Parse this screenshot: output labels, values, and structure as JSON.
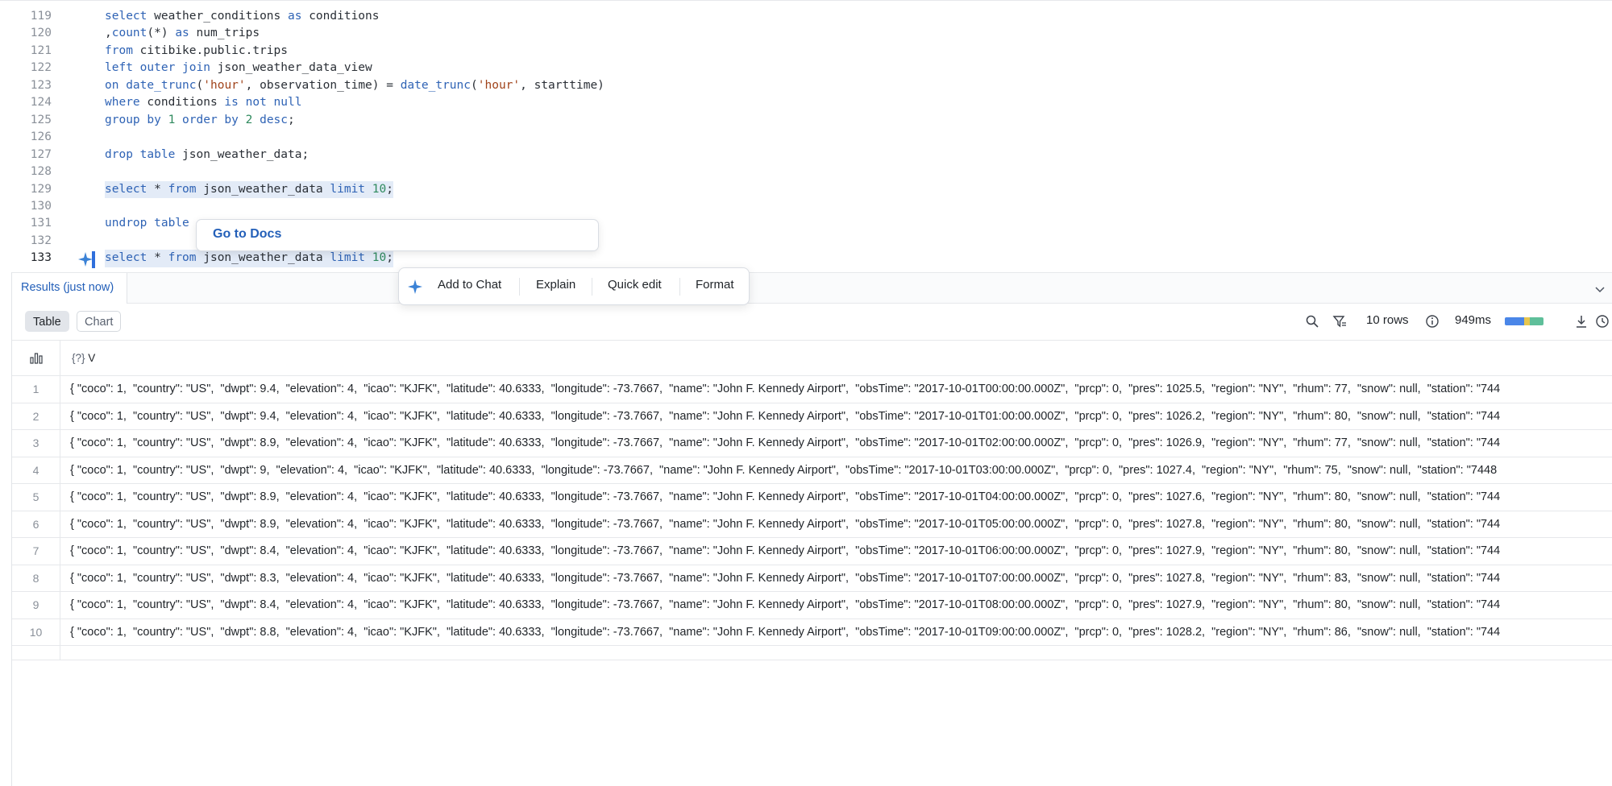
{
  "editor": {
    "lines": [
      {
        "n": "119",
        "segments": [
          {
            "t": "select",
            "c": "kw"
          },
          {
            "t": " weather_conditions "
          },
          {
            "t": "as",
            "c": "kw"
          },
          {
            "t": " conditions"
          }
        ]
      },
      {
        "n": "120",
        "segments": [
          {
            "t": ","
          },
          {
            "t": "count",
            "c": "fn"
          },
          {
            "t": "(*) "
          },
          {
            "t": "as",
            "c": "kw"
          },
          {
            "t": " num_trips"
          }
        ]
      },
      {
        "n": "121",
        "segments": [
          {
            "t": "from",
            "c": "kw"
          },
          {
            "t": " citibike.public.trips"
          }
        ]
      },
      {
        "n": "122",
        "segments": [
          {
            "t": "left outer join",
            "c": "kw"
          },
          {
            "t": " json_weather_data_view"
          }
        ]
      },
      {
        "n": "123",
        "segments": [
          {
            "t": "on",
            "c": "kw"
          },
          {
            "t": " "
          },
          {
            "t": "date_trunc",
            "c": "fn"
          },
          {
            "t": "("
          },
          {
            "t": "'hour'",
            "c": "str"
          },
          {
            "t": ", observation_time) = "
          },
          {
            "t": "date_trunc",
            "c": "fn"
          },
          {
            "t": "("
          },
          {
            "t": "'hour'",
            "c": "str"
          },
          {
            "t": ", starttime)"
          }
        ]
      },
      {
        "n": "124",
        "segments": [
          {
            "t": "where",
            "c": "kw"
          },
          {
            "t": " conditions "
          },
          {
            "t": "is not null",
            "c": "kw"
          }
        ]
      },
      {
        "n": "125",
        "segments": [
          {
            "t": "group by",
            "c": "kw"
          },
          {
            "t": " "
          },
          {
            "t": "1",
            "c": "num"
          },
          {
            "t": " "
          },
          {
            "t": "order by",
            "c": "kw"
          },
          {
            "t": " "
          },
          {
            "t": "2",
            "c": "num"
          },
          {
            "t": " "
          },
          {
            "t": "desc",
            "c": "kw"
          },
          {
            "t": ";"
          }
        ]
      },
      {
        "n": "126",
        "segments": []
      },
      {
        "n": "127",
        "segments": [
          {
            "t": "drop table",
            "c": "kw"
          },
          {
            "t": " json_weather_data;"
          }
        ]
      },
      {
        "n": "128",
        "segments": []
      },
      {
        "n": "129",
        "hl": true,
        "segments": [
          {
            "t": "select",
            "c": "kw"
          },
          {
            "t": " * "
          },
          {
            "t": "from",
            "c": "kw"
          },
          {
            "t": " json_weather_data "
          },
          {
            "t": "limit",
            "c": "kw"
          },
          {
            "t": " "
          },
          {
            "t": "10",
            "c": "num"
          },
          {
            "t": ";"
          }
        ]
      },
      {
        "n": "130",
        "segments": []
      },
      {
        "n": "131",
        "segments": [
          {
            "t": "undrop table",
            "c": "kw"
          }
        ]
      },
      {
        "n": "132",
        "segments": []
      },
      {
        "n": "133",
        "active": true,
        "hl": true,
        "segments": [
          {
            "t": "select",
            "c": "kw"
          },
          {
            "t": " * "
          },
          {
            "t": "from",
            "c": "kw"
          },
          {
            "t": " json_weather_data "
          },
          {
            "t": "limit",
            "c": "kw"
          },
          {
            "t": " "
          },
          {
            "t": "10",
            "c": "num"
          },
          {
            "t": ";"
          }
        ]
      }
    ]
  },
  "docs_popup": {
    "link": "Go to Docs"
  },
  "action_bar": {
    "add_to_chat": "Add to Chat",
    "explain": "Explain",
    "quick_edit": "Quick edit",
    "format": "Format"
  },
  "results": {
    "title": "Results (just now)",
    "tabs": {
      "table": "Table",
      "chart": "Chart"
    },
    "row_count": "10 rows",
    "duration": "949ms",
    "duration_colors": [
      "#4a86e8",
      "#e7c64f",
      "#5fbf9a"
    ],
    "column_type": "{?}",
    "column_name": "V",
    "rows": [
      {
        "n": "1",
        "v": "{ \"coco\": 1,  \"country\": \"US\",  \"dwpt\": 9.4,  \"elevation\": 4,  \"icao\": \"KJFK\",  \"latitude\": 40.6333,  \"longitude\": -73.7667,  \"name\": \"John F. Kennedy Airport\",  \"obsTime\": \"2017-10-01T00:00:00.000Z\",  \"prcp\": 0,  \"pres\": 1025.5,  \"region\": \"NY\",  \"rhum\": 77,  \"snow\": null,  \"station\": \"744"
      },
      {
        "n": "2",
        "v": "{ \"coco\": 1,  \"country\": \"US\",  \"dwpt\": 9.4,  \"elevation\": 4,  \"icao\": \"KJFK\",  \"latitude\": 40.6333,  \"longitude\": -73.7667,  \"name\": \"John F. Kennedy Airport\",  \"obsTime\": \"2017-10-01T01:00:00.000Z\",  \"prcp\": 0,  \"pres\": 1026.2,  \"region\": \"NY\",  \"rhum\": 80,  \"snow\": null,  \"station\": \"744"
      },
      {
        "n": "3",
        "v": "{ \"coco\": 1,  \"country\": \"US\",  \"dwpt\": 8.9,  \"elevation\": 4,  \"icao\": \"KJFK\",  \"latitude\": 40.6333,  \"longitude\": -73.7667,  \"name\": \"John F. Kennedy Airport\",  \"obsTime\": \"2017-10-01T02:00:00.000Z\",  \"prcp\": 0,  \"pres\": 1026.9,  \"region\": \"NY\",  \"rhum\": 77,  \"snow\": null,  \"station\": \"744"
      },
      {
        "n": "4",
        "v": "{ \"coco\": 1,  \"country\": \"US\",  \"dwpt\": 9,  \"elevation\": 4,  \"icao\": \"KJFK\",  \"latitude\": 40.6333,  \"longitude\": -73.7667,  \"name\": \"John F. Kennedy Airport\",  \"obsTime\": \"2017-10-01T03:00:00.000Z\",  \"prcp\": 0,  \"pres\": 1027.4,  \"region\": \"NY\",  \"rhum\": 75,  \"snow\": null,  \"station\": \"7448"
      },
      {
        "n": "5",
        "v": "{ \"coco\": 1,  \"country\": \"US\",  \"dwpt\": 8.9,  \"elevation\": 4,  \"icao\": \"KJFK\",  \"latitude\": 40.6333,  \"longitude\": -73.7667,  \"name\": \"John F. Kennedy Airport\",  \"obsTime\": \"2017-10-01T04:00:00.000Z\",  \"prcp\": 0,  \"pres\": 1027.6,  \"region\": \"NY\",  \"rhum\": 80,  \"snow\": null,  \"station\": \"744"
      },
      {
        "n": "6",
        "v": "{ \"coco\": 1,  \"country\": \"US\",  \"dwpt\": 8.9,  \"elevation\": 4,  \"icao\": \"KJFK\",  \"latitude\": 40.6333,  \"longitude\": -73.7667,  \"name\": \"John F. Kennedy Airport\",  \"obsTime\": \"2017-10-01T05:00:00.000Z\",  \"prcp\": 0,  \"pres\": 1027.8,  \"region\": \"NY\",  \"rhum\": 80,  \"snow\": null,  \"station\": \"744"
      },
      {
        "n": "7",
        "v": "{ \"coco\": 1,  \"country\": \"US\",  \"dwpt\": 8.4,  \"elevation\": 4,  \"icao\": \"KJFK\",  \"latitude\": 40.6333,  \"longitude\": -73.7667,  \"name\": \"John F. Kennedy Airport\",  \"obsTime\": \"2017-10-01T06:00:00.000Z\",  \"prcp\": 0,  \"pres\": 1027.9,  \"region\": \"NY\",  \"rhum\": 80,  \"snow\": null,  \"station\": \"744"
      },
      {
        "n": "8",
        "v": "{ \"coco\": 1,  \"country\": \"US\",  \"dwpt\": 8.3,  \"elevation\": 4,  \"icao\": \"KJFK\",  \"latitude\": 40.6333,  \"longitude\": -73.7667,  \"name\": \"John F. Kennedy Airport\",  \"obsTime\": \"2017-10-01T07:00:00.000Z\",  \"prcp\": 0,  \"pres\": 1027.8,  \"region\": \"NY\",  \"rhum\": 83,  \"snow\": null,  \"station\": \"744"
      },
      {
        "n": "9",
        "v": "{ \"coco\": 1,  \"country\": \"US\",  \"dwpt\": 8.4,  \"elevation\": 4,  \"icao\": \"KJFK\",  \"latitude\": 40.6333,  \"longitude\": -73.7667,  \"name\": \"John F. Kennedy Airport\",  \"obsTime\": \"2017-10-01T08:00:00.000Z\",  \"prcp\": 0,  \"pres\": 1027.9,  \"region\": \"NY\",  \"rhum\": 80,  \"snow\": null,  \"station\": \"744"
      },
      {
        "n": "10",
        "v": "{ \"coco\": 1,  \"country\": \"US\",  \"dwpt\": 8.8,  \"elevation\": 4,  \"icao\": \"KJFK\",  \"latitude\": 40.6333,  \"longitude\": -73.7667,  \"name\": \"John F. Kennedy Airport\",  \"obsTime\": \"2017-10-01T09:00:00.000Z\",  \"prcp\": 0,  \"pres\": 1028.2,  \"region\": \"NY\",  \"rhum\": 86,  \"snow\": null,  \"station\": \"744"
      }
    ]
  },
  "icons": {
    "sparkle": "sparkle-icon",
    "collapse": "chevron-down-icon",
    "search": "search-icon",
    "filter": "filter-icon",
    "info": "info-icon",
    "download": "download-icon",
    "history": "clock-icon",
    "column_stats": "column-stats-icon"
  }
}
